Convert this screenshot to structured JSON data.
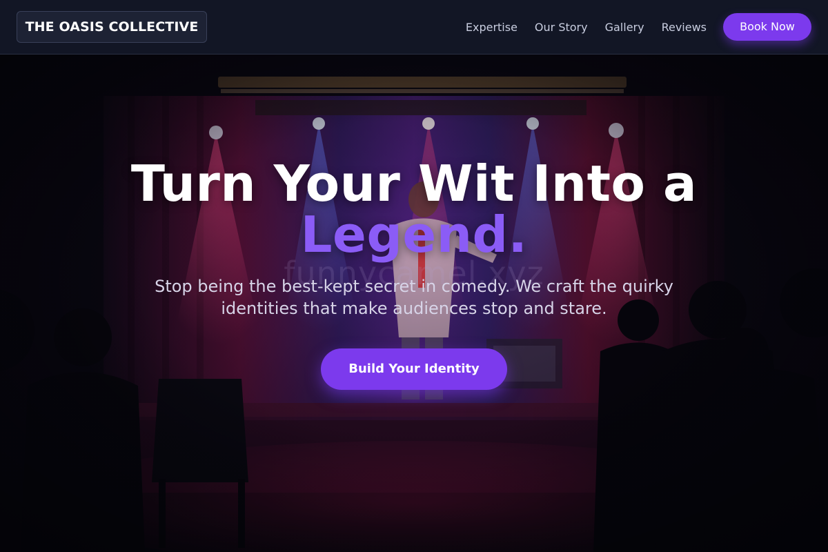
{
  "nav": {
    "brand": "THE OASIS COLLECTIVE",
    "links": [
      {
        "label": "Expertise"
      },
      {
        "label": "Our Story"
      },
      {
        "label": "Gallery"
      },
      {
        "label": "Reviews"
      }
    ],
    "cta_label": "Book Now"
  },
  "hero": {
    "title_line1": "Turn Your Wit Into a",
    "title_accent": "Legend.",
    "subtitle": "Stop being the best-kept secret in comedy. We craft the quirky identities that make audiences stop and stare.",
    "cta_label": "Build Your Identity",
    "watermark": "funnycamel.xyz"
  },
  "colors": {
    "accent": "#7c3aed",
    "accent_text": "#8b5cf6",
    "nav_bg": "#121625",
    "hero_bg": "#08070f"
  }
}
